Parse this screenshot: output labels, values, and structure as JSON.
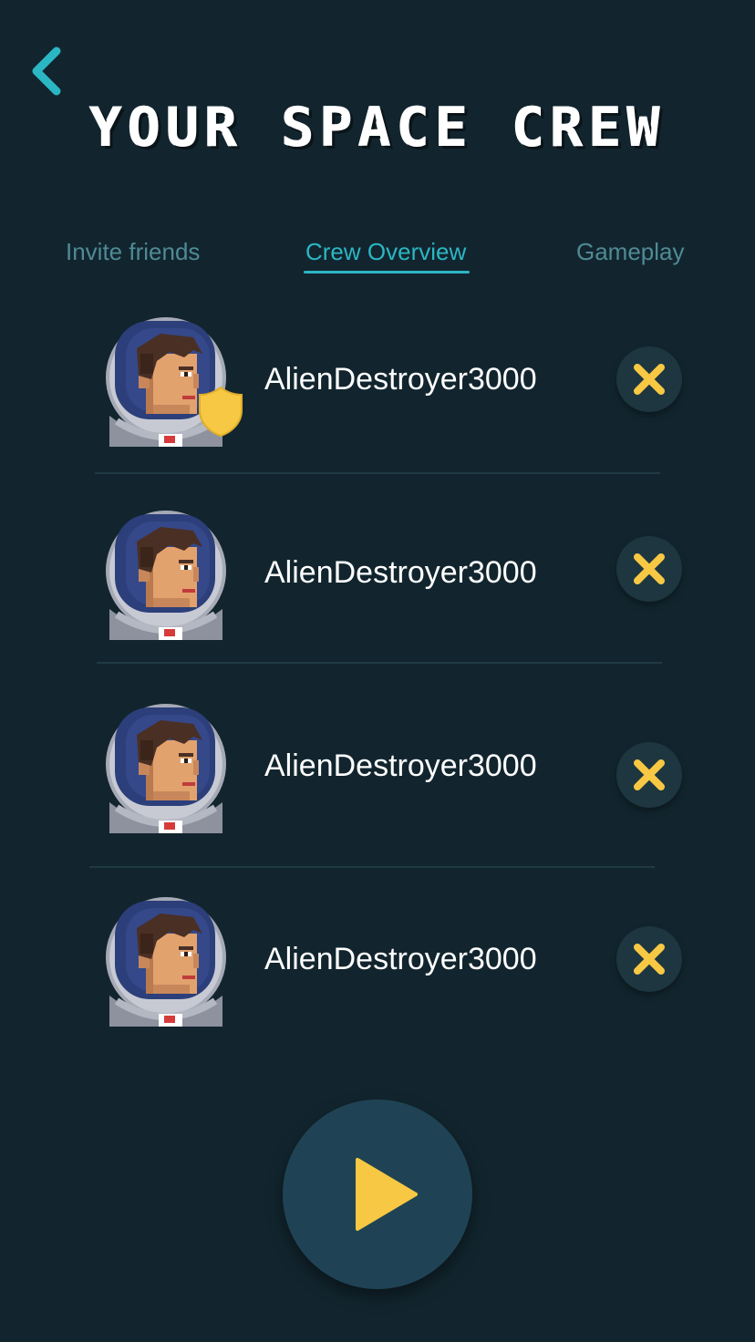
{
  "header": {
    "back_icon": "chevron-left-icon",
    "title": "YOUR SPACE CREW"
  },
  "tabs": [
    {
      "label": "Invite friends",
      "active": false
    },
    {
      "label": "Crew Overview",
      "active": true
    },
    {
      "label": "Gameplay",
      "active": false
    }
  ],
  "crew": [
    {
      "name": "AlienDestroyer3000",
      "is_captain": true,
      "remove_icon": "close-icon"
    },
    {
      "name": "AlienDestroyer3000",
      "is_captain": false,
      "remove_icon": "close-icon"
    },
    {
      "name": "AlienDestroyer3000",
      "is_captain": false,
      "remove_icon": "close-icon"
    },
    {
      "name": "AlienDestroyer3000",
      "is_captain": false,
      "remove_icon": "close-icon"
    }
  ],
  "play": {
    "icon": "play-icon"
  },
  "colors": {
    "background": "#12252e",
    "accent_teal": "#2bb6c4",
    "inactive_tab": "#4f8a96",
    "accent_yellow": "#f7c843",
    "button_bg": "#1d3640",
    "play_bg": "#1f4354"
  }
}
